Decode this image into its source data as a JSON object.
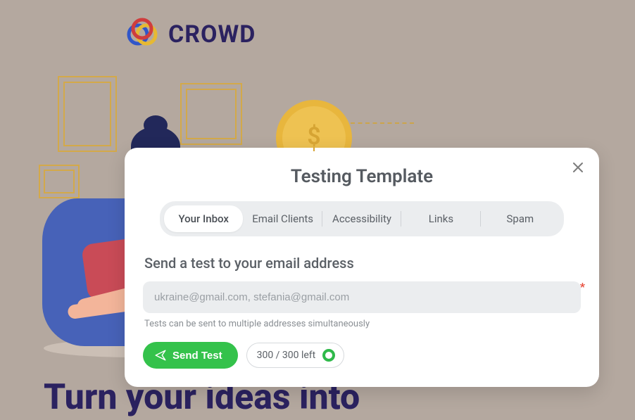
{
  "brand": {
    "name": "CROWD"
  },
  "headline": "Turn your ideas into",
  "modal": {
    "title": "Testing Template",
    "tabs": [
      {
        "label": "Your Inbox",
        "active": true
      },
      {
        "label": "Email Clients",
        "active": false
      },
      {
        "label": "Accessibility",
        "active": false
      },
      {
        "label": "Links",
        "active": false
      },
      {
        "label": "Spam",
        "active": false
      }
    ],
    "section_label": "Send a test to your email address",
    "email_placeholder": "ukraine@gmail.com, stefania@gmail.com",
    "email_value": "",
    "helper": "Tests can be sent to multiple addresses simultaneously",
    "send_label": "Send Test",
    "quota": "300 / 300 left",
    "required_marker": "*"
  }
}
